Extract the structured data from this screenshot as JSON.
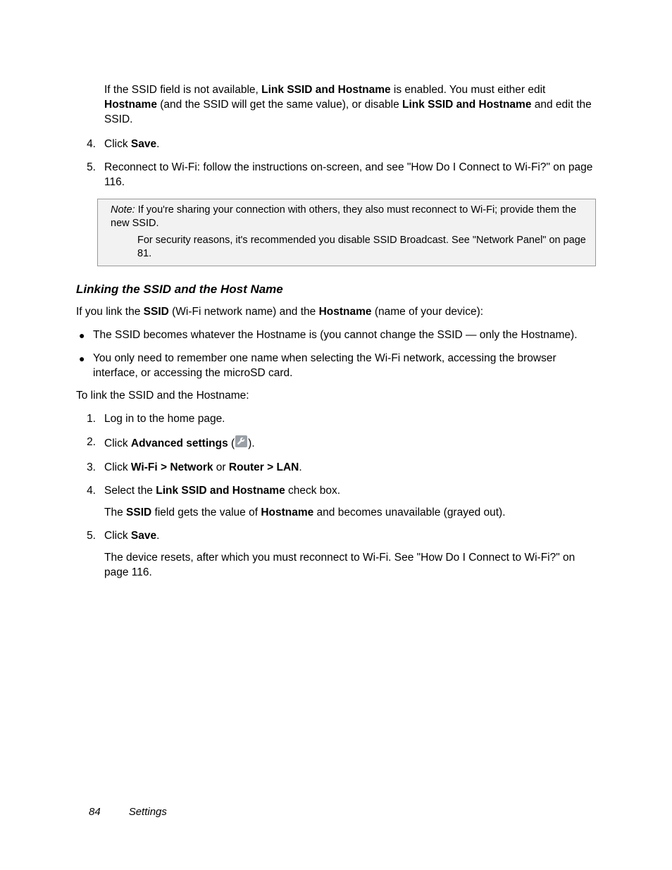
{
  "intro": {
    "text_before_bold1": "If the SSID field is not available, ",
    "bold1": "Link SSID and Hostname",
    "text_mid1": " is enabled. You must either edit ",
    "bold2": "Hostname",
    "text_mid2": " (and the SSID will get the same value), or disable ",
    "bold3": "Link SSID and Hostname",
    "text_after": " and edit the SSID."
  },
  "step4": {
    "num": "4.",
    "pre": "Click ",
    "bold": "Save",
    "post": "."
  },
  "step5": {
    "num": "5.",
    "text": "Reconnect to Wi-Fi: follow the instructions on-screen, and see \"How Do I Connect to Wi-Fi?\" on page 116."
  },
  "note": {
    "label": "Note:",
    "line1": " If you're sharing your connection with others, they also must reconnect to Wi-Fi; provide them the new SSID.",
    "line2": "For security reasons, it's recommended you disable SSID Broadcast. See \"Network Panel\" on page 81."
  },
  "heading": "Linking the SSID and the Host Name",
  "p1": {
    "pre": "If you link the ",
    "b1": "SSID",
    "mid1": " (Wi-Fi network name) and the ",
    "b2": "Hostname",
    "post": " (name of your device):"
  },
  "bullet1": "The SSID becomes whatever the Hostname is (you cannot change the SSID — only the Hostname).",
  "bullet2": "You only need to remember one name when selecting the Wi-Fi network, accessing the browser interface, or accessing the microSD card.",
  "p2": "To link the SSID and the Hostname:",
  "l1": {
    "num": "1.",
    "text": "Log in to the home page."
  },
  "l2": {
    "num": "2.",
    "pre": "Click ",
    "bold": "Advanced settings",
    "open": " (",
    "close": ")."
  },
  "l3": {
    "num": "3.",
    "pre": "Click ",
    "b1": "Wi-Fi",
    "gt1": " > ",
    "b2": "Network",
    "or": " or ",
    "b3": "Router",
    "gt2": " > ",
    "b4": "LAN",
    "post": "."
  },
  "l4": {
    "num": "4.",
    "pre": "Select the ",
    "bold": "Link SSID and Hostname",
    "post": " check box.",
    "sub_pre": "The ",
    "sub_b1": "SSID",
    "sub_mid": " field gets the value of ",
    "sub_b2": "Hostname",
    "sub_post": " and becomes unavailable (grayed out)."
  },
  "l5": {
    "num": "5.",
    "pre": "Click ",
    "bold": "Save",
    "post": ".",
    "sub": "The device resets, after which you must reconnect to Wi-Fi. See \"How Do I Connect to Wi-Fi?\" on page 116."
  },
  "footer": {
    "page": "84",
    "section": "Settings"
  }
}
